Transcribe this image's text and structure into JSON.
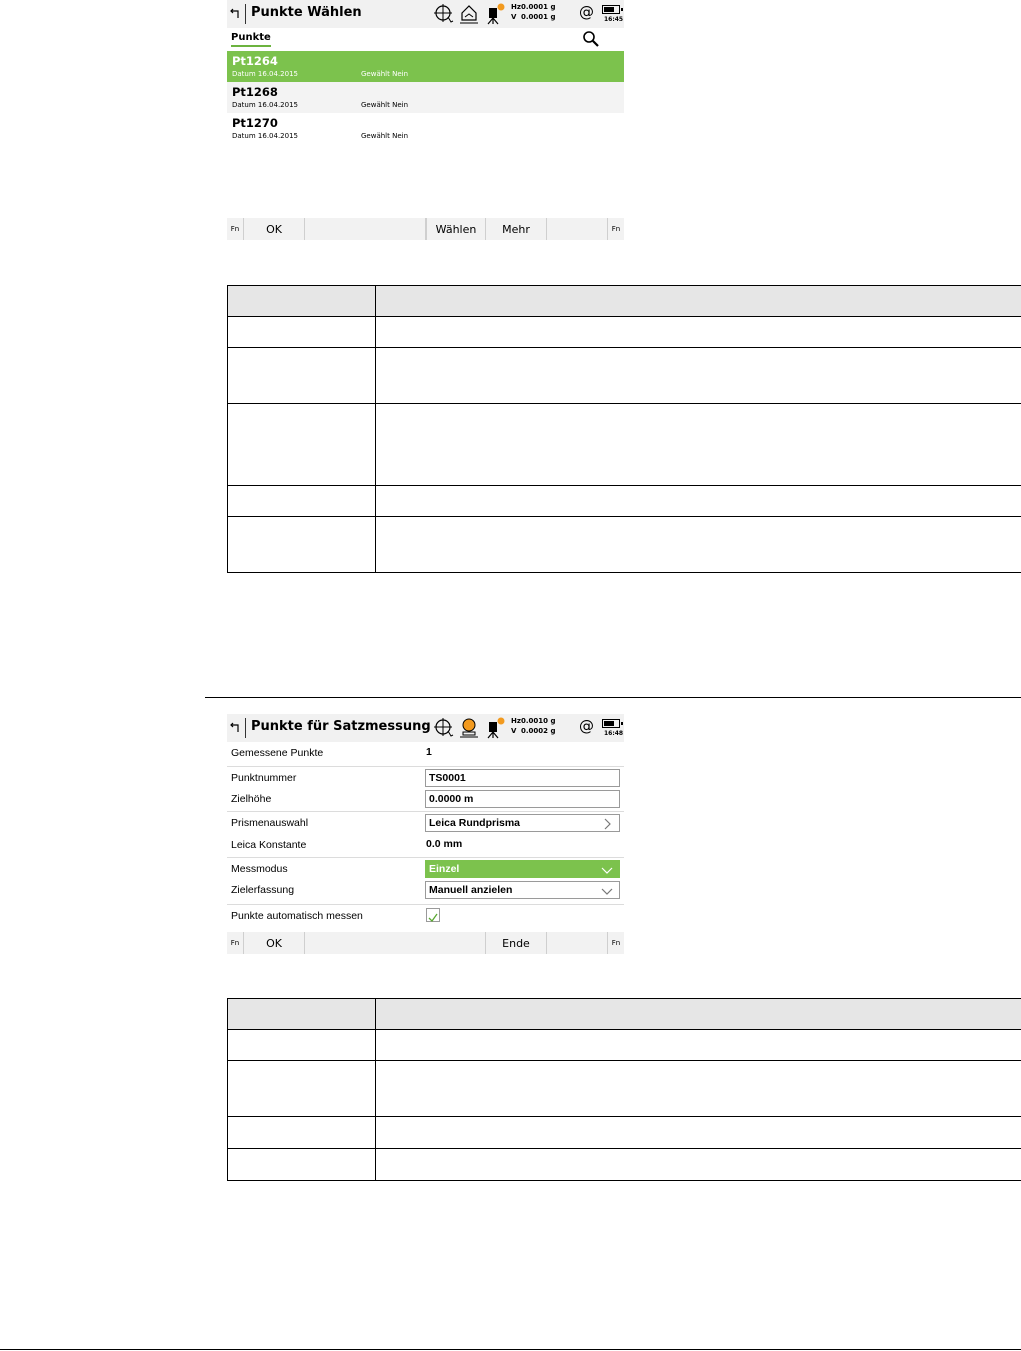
{
  "screen1": {
    "title": "Punkte Wählen",
    "hz_label": "Hz",
    "hz_value": "0.0001 g",
    "v_label": "V",
    "v_value": "0.0001 g",
    "time": "16:45",
    "tab": "Punkte",
    "points": [
      {
        "name": "Pt1264",
        "date_label": "Datum",
        "date": "16.04.2015",
        "selected_label": "Gewählt",
        "selected": "Nein"
      },
      {
        "name": "Pt1268",
        "date_label": "Datum",
        "date": "16.04.2015",
        "selected_label": "Gewählt",
        "selected": "Nein"
      },
      {
        "name": "Pt1270",
        "date_label": "Datum",
        "date": "16.04.2015",
        "selected_label": "Gewählt",
        "selected": "Nein"
      }
    ],
    "softkeys": {
      "fn": "Fn",
      "ok": "OK",
      "select": "Wählen",
      "more": "Mehr"
    }
  },
  "screen2": {
    "title": "Punkte für Satzmessung",
    "hz_label": "Hz",
    "hz_value": "0.0010 g",
    "v_label": "V",
    "v_value": "0.0002 g",
    "time": "16:48",
    "fields": {
      "measured_points": {
        "label": "Gemessene Punkte",
        "value": "1"
      },
      "point_id": {
        "label": "Punktnummer",
        "value": "TS0001"
      },
      "target_height": {
        "label": "Zielhöhe",
        "value": "0.0000 m"
      },
      "prism": {
        "label": "Prismenauswahl",
        "value": "Leica Rundprisma"
      },
      "leica_constant": {
        "label": "Leica Konstante",
        "value": "0.0 mm"
      },
      "measure_mode": {
        "label": "Messmodus",
        "value": "Einzel"
      },
      "target_aiming": {
        "label": "Zielerfassung",
        "value": "Manuell anzielen"
      },
      "auto_measure": {
        "label": "Punkte automatisch messen",
        "checked": true
      }
    },
    "softkeys": {
      "fn": "Fn",
      "ok": "OK",
      "end": "Ende"
    }
  },
  "colors": {
    "accent_green": "#7cc24d",
    "header_gray": "#e6e6e6"
  }
}
